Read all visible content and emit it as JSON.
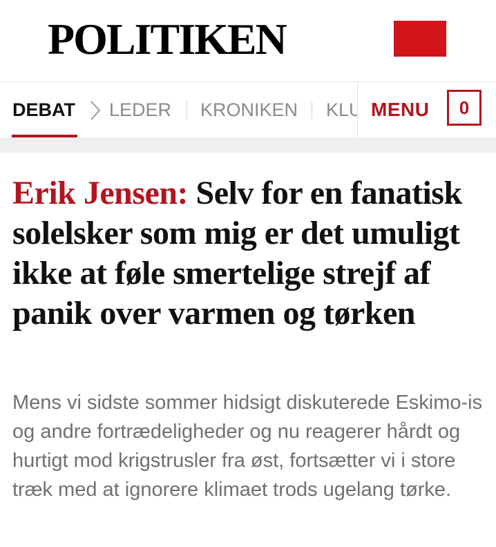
{
  "header": {
    "logo": "POLITIKEN",
    "brand_color": "#d3141b"
  },
  "nav": {
    "items": [
      {
        "label": "DEBAT",
        "active": true
      },
      {
        "label": "LEDER",
        "active": false
      },
      {
        "label": "KRONIKEN",
        "active": false
      },
      {
        "label": "KLU",
        "active": false
      }
    ],
    "menu_label": "MENU",
    "count": "0",
    "accent_color": "#b3141f"
  },
  "article": {
    "author": "Erik Jensen:",
    "title": "Selv for en fanatisk solelsker som mig er det umuligt ikke at føle smertelige strejf af panik over varmen og tørken",
    "subtitle": "Mens vi sidste sommer hidsigt diskuterede Eskimo-is og andre fortrædeligheder og nu reagerer hårdt og hurtigt mod krigstrusler fra øst, fortsætter vi i store træk med at ignorere klimaet trods ugelang tørke.",
    "author_color": "#b3141f"
  }
}
